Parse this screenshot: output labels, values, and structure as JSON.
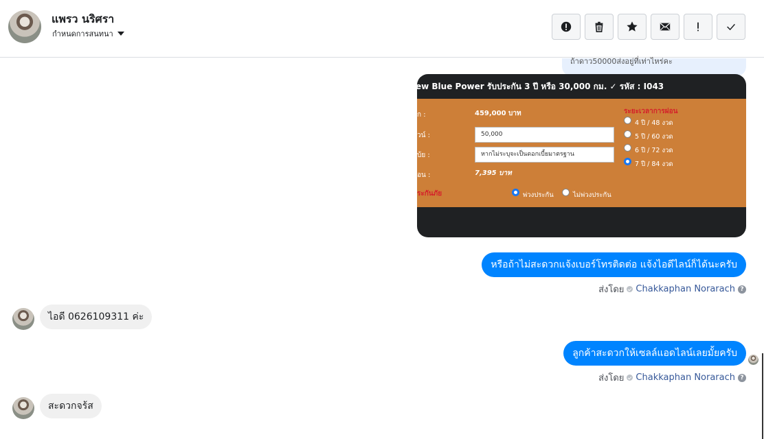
{
  "header": {
    "contact_name": "แพรว นริศรา",
    "assign_label": "กำหนดการสนทนา",
    "toolbar": [
      {
        "name": "spam",
        "icon": "alert-circle-icon"
      },
      {
        "name": "delete",
        "icon": "trash-icon"
      },
      {
        "name": "star",
        "icon": "star-icon"
      },
      {
        "name": "mark-unread",
        "icon": "envelope-icon"
      },
      {
        "name": "follow-up",
        "icon": "exclamation-icon"
      },
      {
        "name": "done",
        "icon": "check-icon"
      }
    ]
  },
  "conversation": {
    "prev_bubble_text": "ถ้าดาว50000ส่งอยู่ที่เท่าไหร่คะ",
    "card": {
      "title": "ew Blue Power รับประกัน 3 ปี หรือ 30,000 กม. ✓ รหัส : I043",
      "rows": [
        {
          "label": "ก :",
          "value": "459,000 บาท"
        },
        {
          "label": "วน์ :",
          "input": "50,000"
        },
        {
          "label": "บ้ย :",
          "input": "หากไม่ระบุจะเป็นดอกเบี้ยมาตรฐาน"
        },
        {
          "label": "อน :",
          "value": "7,395 บาท"
        }
      ],
      "insurance_label": "ระกันภัย",
      "insurance_options": [
        {
          "label": "พ่วงประกัน",
          "selected": true
        },
        {
          "label": "ไม่พ่วงประกัน",
          "selected": false
        }
      ],
      "term_title": "ระยะเวลาการผ่อน",
      "terms": [
        {
          "label": "4 ปี / 48 งวด",
          "selected": false
        },
        {
          "label": "5 ปี / 60 งวด",
          "selected": false
        },
        {
          "label": "6 ปี / 72 งวด",
          "selected": false
        },
        {
          "label": "7 ปี / 84 งวด",
          "selected": true
        }
      ]
    },
    "messages": [
      {
        "dir": "out",
        "text": "หรือถ้าไม่สะดวกแจ้งเบอร์โทรติดต่อ แจ้งไอดีไลน์ก็ได้นะครับ",
        "sent_by_prefix": "ส่งโดย",
        "sent_by": "Chakkaphan Norarach"
      },
      {
        "dir": "in",
        "text": "ไอดี 0626109311 ค่ะ"
      },
      {
        "dir": "out",
        "text": "ลูกค้าสะดวกให้เซลล์แอดไลน์เลยมั้ยครับ",
        "sent_by_prefix": "ส่งโดย",
        "sent_by": "Chakkaphan Norarach"
      },
      {
        "dir": "in",
        "text": "สะดวกจร้ส"
      }
    ]
  },
  "colors": {
    "outgoing_bubble": "#0084ff",
    "incoming_bubble": "#f0f0f0",
    "card_body": "#cd7f38",
    "card_dark": "#1f2123",
    "accent_red": "#d4202a"
  }
}
